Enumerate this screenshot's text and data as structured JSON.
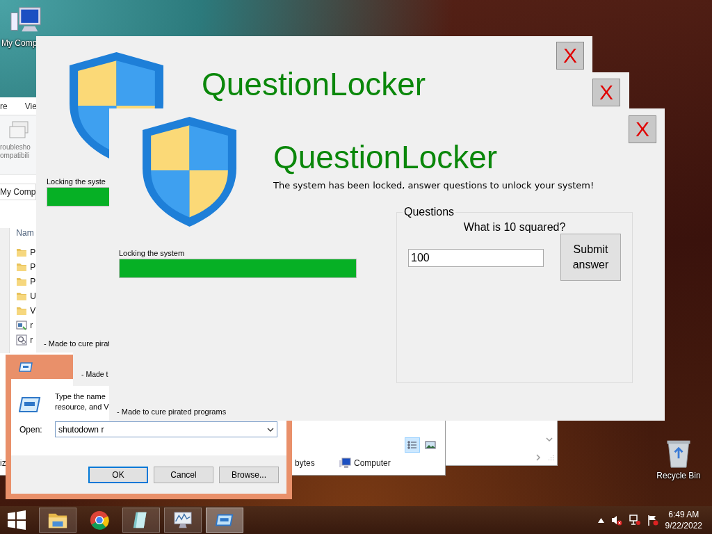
{
  "desktop_icons": [
    {
      "kind": "computer",
      "label": "My Comp"
    },
    {
      "kind": "recycle_bin",
      "label": "Recycle Bin"
    }
  ],
  "explorer": {
    "ribbon_tabs": [
      "re",
      "Vie"
    ],
    "ribbon_button": [
      "roublesho",
      "ompatibili"
    ],
    "address": "My Comp",
    "column_header": "Nam",
    "files": [
      {
        "kind": "folder",
        "name": "P"
      },
      {
        "kind": "folder",
        "name": "P"
      },
      {
        "kind": "folder",
        "name": "P"
      },
      {
        "kind": "folder",
        "name": "U"
      },
      {
        "kind": "folder",
        "name": "V"
      },
      {
        "kind": "program",
        "name": "r"
      },
      {
        "kind": "settings",
        "name": "r"
      }
    ],
    "view_buttons": [
      {
        "kind": "details",
        "selected": true
      },
      {
        "kind": "large_icons",
        "selected": false
      }
    ],
    "status_bar": {
      "count": "iz",
      "size": "bytes",
      "location": "Computer"
    }
  },
  "locker_back": {
    "title": "QuestionLocker",
    "close": "X",
    "progress_label": "Locking the syste",
    "level": 1,
    "footer": "- Made to cure pirat"
  },
  "locker_middle": {
    "close": "X",
    "footer": "- Made t"
  },
  "run_dialog": {
    "prompt": [
      "Type the name",
      "resource, and V"
    ],
    "open_label": "Open:",
    "command": "shutodown r",
    "buttons": [
      {
        "label": "OK",
        "default": true
      },
      {
        "label": "Cancel",
        "default": false
      },
      {
        "label": "Browse...",
        "default": false
      }
    ]
  },
  "locker_front": {
    "title": "QuestionLocker",
    "subtitle": "The system has been locked, answer questions to unlock your system!",
    "close": "X",
    "progress_label": "Locking the system",
    "level": 1,
    "footer": "- Made to cure pirated programs",
    "questions": {
      "legend": "Questions",
      "question": "What is 10 squared?",
      "answer": "100",
      "submit": "Submit answer"
    }
  },
  "taskbar": {
    "apps": [
      {
        "kind": "explorer",
        "running": true,
        "selected": false
      },
      {
        "kind": "chrome",
        "running": false,
        "selected": false
      },
      {
        "kind": "notepad",
        "running": true,
        "selected": false
      },
      {
        "kind": "monitor",
        "running": true,
        "selected": false
      },
      {
        "kind": "run",
        "running": true,
        "selected": true
      }
    ],
    "clock": {
      "time": "6:49 AM",
      "date": "9/22/2022"
    }
  }
}
